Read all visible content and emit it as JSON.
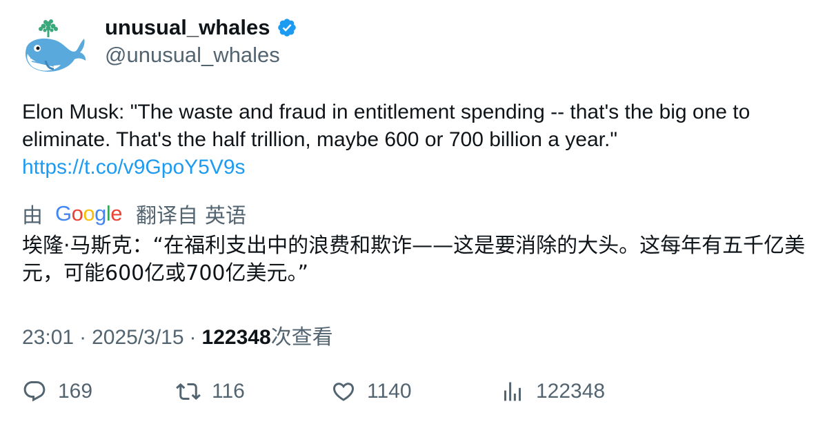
{
  "user": {
    "display_name": "unusual_whales",
    "handle": "@unusual_whales",
    "verified": true,
    "avatar_icon": "whale-icon"
  },
  "tweet": {
    "text": "Elon Musk: \"The waste and fraud in entitlement spending -- that's the big one to eliminate. That's the half trillion, maybe 600 or 700 billion a year.\"",
    "link": "https://t.co/v9GpoY5V9s"
  },
  "translation": {
    "by_label": "由",
    "provider": "Google",
    "translated_from": "翻译自",
    "language": "英语",
    "text": "埃隆·马斯克：“在福利支出中的浪费和欺诈——这是要消除的大头。这每年有五千亿美元，可能600亿或700亿美元。”"
  },
  "meta": {
    "time": "23:01",
    "separator": "·",
    "date": "2025/3/15",
    "views_count": "122348",
    "views_label": "次查看"
  },
  "actions": {
    "reply_count": "169",
    "retweet_count": "116",
    "like_count": "1140",
    "views_count": "122348"
  },
  "colors": {
    "link": "#1d9bf0",
    "secondary_text": "#536471",
    "primary_text": "#0f1419",
    "verified_badge": "#1d9bf0"
  }
}
